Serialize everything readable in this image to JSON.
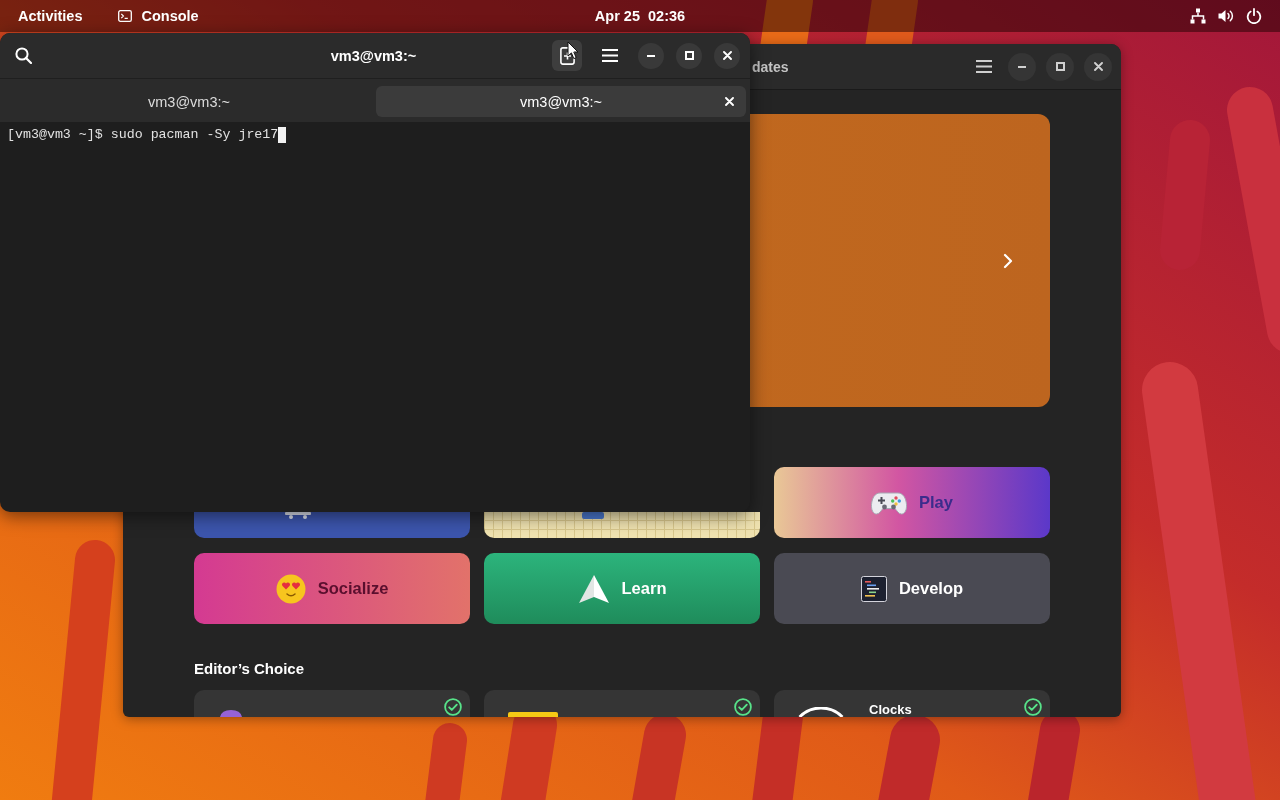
{
  "top_bar": {
    "activities": "Activities",
    "app_menu": "Console",
    "clock": "Apr 25  02:36"
  },
  "software_window": {
    "view_label": "dates",
    "categories": [
      {
        "kind": "wheels"
      },
      {
        "kind": "grid"
      },
      {
        "kind": "gamepad",
        "label": "Play"
      },
      {
        "kind": "emoji",
        "label": "Socialize"
      },
      {
        "kind": "plane",
        "label": "Learn"
      },
      {
        "kind": "code",
        "label": "Develop"
      }
    ],
    "editors_choice": {
      "heading": "Editor’s Choice",
      "apps": [
        {
          "kind": "blob",
          "installed": true
        },
        {
          "kind": "note",
          "installed": true
        },
        {
          "kind": "ring",
          "name": "Clocks",
          "installed": true
        }
      ]
    }
  },
  "terminal": {
    "title": "vm3@vm3:~",
    "new_tab_highlighted": true,
    "tabs": [
      {
        "label": "vm3@vm3:~",
        "selected": false
      },
      {
        "label": "vm3@vm3:~",
        "selected": true
      }
    ],
    "lines": [
      "[vm3@vm3 ~]$ sudo pacman -Sy jre17"
    ]
  }
}
